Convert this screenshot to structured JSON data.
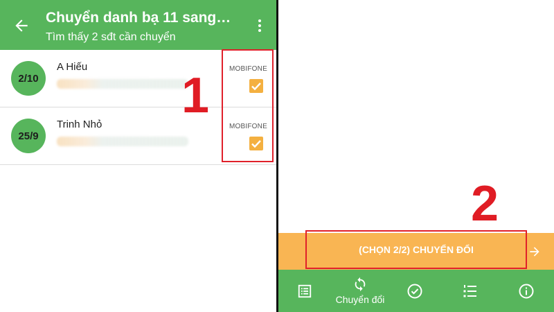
{
  "header": {
    "title": "Chuyển danh bạ 11 sang…",
    "subtitle": "Tìm thấy 2 sđt cần chuyển"
  },
  "contacts": [
    {
      "date": "2/10",
      "name": "A Hiếu",
      "carrier": "MOBIFONE",
      "checked": true
    },
    {
      "date": "25/9",
      "name": "Trinh Nhỏ",
      "carrier": "MOBIFONE",
      "checked": true
    }
  ],
  "annotations": {
    "step1": "1",
    "step2": "2"
  },
  "action": {
    "convert_label": "(CHỌN 2/2) CHUYỂN ĐỔI"
  },
  "bottom_nav": {
    "items": [
      {
        "icon": "list-icon",
        "label": ""
      },
      {
        "icon": "sync-icon",
        "label": "Chuyển đổi"
      },
      {
        "icon": "check-circle-icon",
        "label": ""
      },
      {
        "icon": "numbered-list-icon",
        "label": ""
      },
      {
        "icon": "info-icon",
        "label": ""
      }
    ]
  },
  "colors": {
    "appbar_green": "#57b55c",
    "accent_orange": "#f9b553",
    "checkbox_orange": "#f4b040",
    "highlight_red": "#e0202a"
  }
}
